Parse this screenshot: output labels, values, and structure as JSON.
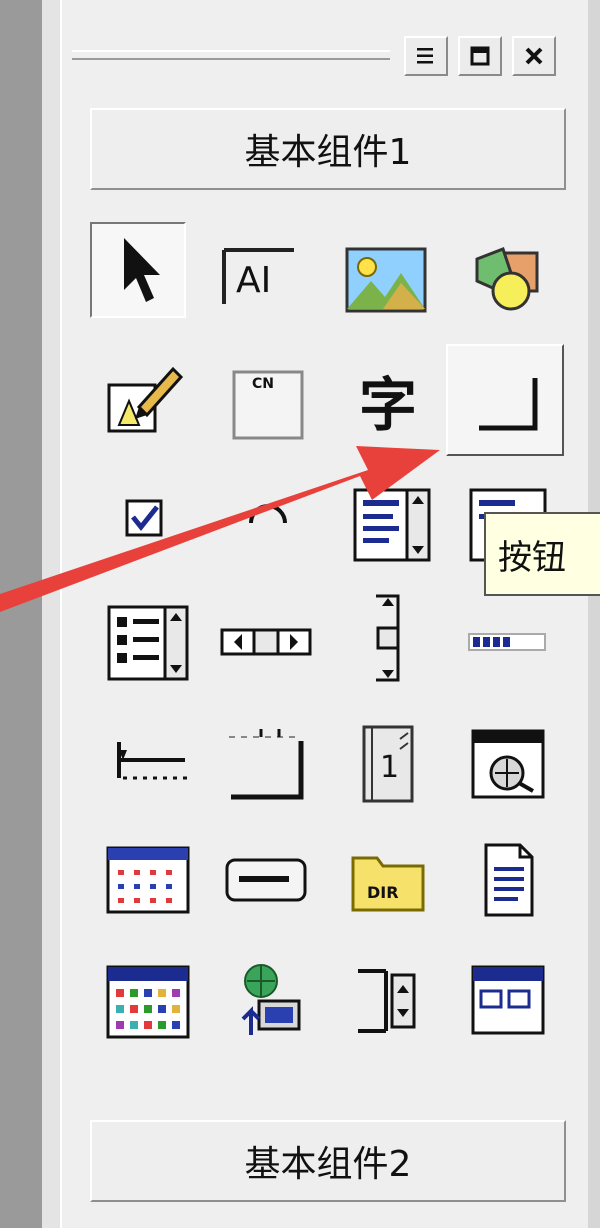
{
  "window": {
    "controls": [
      {
        "name": "menu-lines-icon"
      },
      {
        "name": "restore-icon"
      },
      {
        "name": "close-icon"
      }
    ]
  },
  "groups": {
    "group1_label": "基本组件1",
    "group2_label": "基本组件2"
  },
  "tools": [
    {
      "name": "pointer-tool-icon",
      "state": "selected"
    },
    {
      "name": "label-tool-icon"
    },
    {
      "name": "picture-tool-icon"
    },
    {
      "name": "shapes-tool-icon"
    },
    {
      "name": "edit-box-tool-icon"
    },
    {
      "name": "cn-box-tool-icon"
    },
    {
      "name": "text-char-tool-icon",
      "glyph": "字"
    },
    {
      "name": "button-tool-icon",
      "state": "hovered"
    },
    {
      "name": "checkbox-tool-icon"
    },
    {
      "name": "radio-tool-icon"
    },
    {
      "name": "listbox-tool-icon"
    },
    {
      "name": "combobox-tool-icon"
    },
    {
      "name": "option-list-tool-icon"
    },
    {
      "name": "hscrollbar-tool-icon"
    },
    {
      "name": "vscrollbar-tool-icon"
    },
    {
      "name": "progressbar-tool-icon"
    },
    {
      "name": "slider-tool-icon"
    },
    {
      "name": "tab-control-tool-icon"
    },
    {
      "name": "media-clip-tool-icon"
    },
    {
      "name": "web-browser-tool-icon"
    },
    {
      "name": "grid-table-tool-icon"
    },
    {
      "name": "status-bar-tool-icon"
    },
    {
      "name": "dir-box-tool-icon",
      "text": "DIR"
    },
    {
      "name": "file-box-tool-icon"
    },
    {
      "name": "color-picker-tool-icon"
    },
    {
      "name": "network-tool-icon"
    },
    {
      "name": "spin-tool-icon"
    },
    {
      "name": "window-tool-icon"
    }
  ],
  "tooltip": {
    "text": "按钮"
  },
  "colors": {
    "annotation_arrow": "#e8403a",
    "tooltip_bg": "#ffffe1",
    "panel_bg": "#efefef"
  }
}
